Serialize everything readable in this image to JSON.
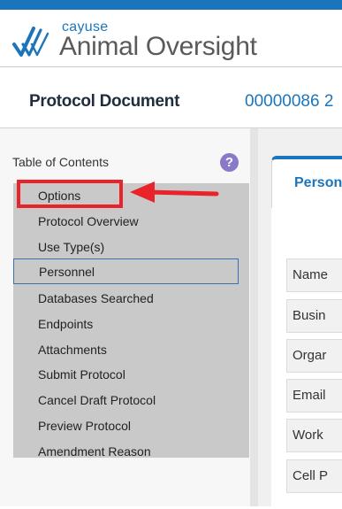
{
  "brand": {
    "small": "cayuse",
    "big": "Animal Oversight"
  },
  "protocol": {
    "title": "Protocol Document",
    "number": "00000086 2"
  },
  "toc": {
    "header": "Table of Contents",
    "help": "?",
    "items": [
      {
        "label": "Options"
      },
      {
        "label": "Protocol Overview"
      },
      {
        "label": "Use Type(s)"
      },
      {
        "label": "Personnel"
      },
      {
        "label": "Databases Searched"
      },
      {
        "label": "Endpoints"
      },
      {
        "label": "Attachments"
      },
      {
        "label": "Submit Protocol"
      },
      {
        "label": "Cancel Draft Protocol"
      },
      {
        "label": "Preview Protocol"
      },
      {
        "label": "Amendment Reason"
      }
    ],
    "selected_index": 3
  },
  "content": {
    "tab_label": "Person",
    "fields": [
      "Name",
      "Busin",
      "Orgar",
      "Email",
      "Work",
      "Cell P"
    ]
  },
  "colors": {
    "brand_blue": "#1b75bc",
    "annotation_red": "#e8232a",
    "selected_border": "#3a6fb5"
  }
}
